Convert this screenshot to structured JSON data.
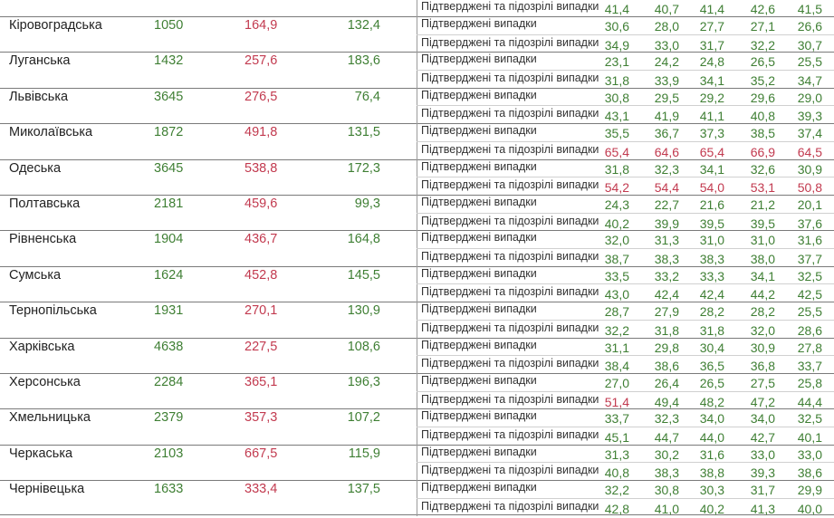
{
  "row_labels": {
    "confirmed": "Підтверджені випадки",
    "confirmed_suspected": "Підтверджені та підозрілі випадки"
  },
  "colors": {
    "green": "#3f7f34",
    "red": "#c23a4f"
  },
  "partial_top_row": {
    "label": "Підтверджені та підозрілі випадки",
    "values": [
      "41,4",
      "40,7",
      "41,4",
      "42,6",
      "41,5"
    ],
    "tones": [
      "green",
      "green",
      "green",
      "green",
      "green"
    ]
  },
  "regions": [
    {
      "name": "Кіровоградська",
      "total": "1050",
      "rate": "164,9",
      "third": "132,4",
      "confirmed": {
        "values": [
          "30,6",
          "28,0",
          "27,7",
          "27,1",
          "26,6"
        ],
        "tones": [
          "green",
          "green",
          "green",
          "green",
          "green"
        ]
      },
      "confirmed_suspected": {
        "values": [
          "34,9",
          "33,0",
          "31,7",
          "32,2",
          "30,7"
        ],
        "tones": [
          "green",
          "green",
          "green",
          "green",
          "green"
        ]
      }
    },
    {
      "name": "Луганська",
      "total": "1432",
      "rate": "257,6",
      "third": "183,6",
      "confirmed": {
        "values": [
          "23,1",
          "24,2",
          "24,8",
          "26,5",
          "25,5"
        ],
        "tones": [
          "green",
          "green",
          "green",
          "green",
          "green"
        ]
      },
      "confirmed_suspected": {
        "values": [
          "31,8",
          "33,9",
          "34,1",
          "35,2",
          "34,7"
        ],
        "tones": [
          "green",
          "green",
          "green",
          "green",
          "green"
        ]
      }
    },
    {
      "name": "Львівська",
      "total": "3645",
      "rate": "276,5",
      "third": "76,4",
      "confirmed": {
        "values": [
          "30,8",
          "29,5",
          "29,2",
          "29,6",
          "29,0"
        ],
        "tones": [
          "green",
          "green",
          "green",
          "green",
          "green"
        ]
      },
      "confirmed_suspected": {
        "values": [
          "43,1",
          "41,9",
          "41,1",
          "40,8",
          "39,3"
        ],
        "tones": [
          "green",
          "green",
          "green",
          "green",
          "green"
        ]
      }
    },
    {
      "name": "Миколаївська",
      "total": "1872",
      "rate": "491,8",
      "third": "131,5",
      "confirmed": {
        "values": [
          "35,5",
          "36,7",
          "37,3",
          "38,5",
          "37,4"
        ],
        "tones": [
          "green",
          "green",
          "green",
          "green",
          "green"
        ]
      },
      "confirmed_suspected": {
        "values": [
          "65,4",
          "64,6",
          "65,4",
          "66,9",
          "64,5"
        ],
        "tones": [
          "red",
          "red",
          "red",
          "red",
          "red"
        ]
      }
    },
    {
      "name": "Одеська",
      "total": "3645",
      "rate": "538,8",
      "third": "172,3",
      "confirmed": {
        "values": [
          "31,8",
          "32,3",
          "34,1",
          "32,6",
          "30,9"
        ],
        "tones": [
          "green",
          "green",
          "green",
          "green",
          "green"
        ]
      },
      "confirmed_suspected": {
        "values": [
          "54,2",
          "54,4",
          "54,0",
          "53,1",
          "50,8"
        ],
        "tones": [
          "red",
          "red",
          "red",
          "red",
          "red"
        ]
      }
    },
    {
      "name": "Полтавська",
      "total": "2181",
      "rate": "459,6",
      "third": "99,3",
      "confirmed": {
        "values": [
          "24,3",
          "22,7",
          "21,6",
          "21,2",
          "20,1"
        ],
        "tones": [
          "green",
          "green",
          "green",
          "green",
          "green"
        ]
      },
      "confirmed_suspected": {
        "values": [
          "40,2",
          "39,9",
          "39,5",
          "39,5",
          "37,6"
        ],
        "tones": [
          "green",
          "green",
          "green",
          "green",
          "green"
        ]
      }
    },
    {
      "name": "Рівненська",
      "total": "1904",
      "rate": "436,7",
      "third": "164,8",
      "confirmed": {
        "values": [
          "32,0",
          "31,3",
          "31,0",
          "31,0",
          "31,6"
        ],
        "tones": [
          "green",
          "green",
          "green",
          "green",
          "green"
        ]
      },
      "confirmed_suspected": {
        "values": [
          "38,7",
          "38,3",
          "38,3",
          "38,0",
          "37,7"
        ],
        "tones": [
          "green",
          "green",
          "green",
          "green",
          "green"
        ]
      }
    },
    {
      "name": "Сумська",
      "total": "1624",
      "rate": "452,8",
      "third": "145,5",
      "confirmed": {
        "values": [
          "33,5",
          "33,2",
          "33,3",
          "34,1",
          "32,5"
        ],
        "tones": [
          "green",
          "green",
          "green",
          "green",
          "green"
        ]
      },
      "confirmed_suspected": {
        "values": [
          "43,0",
          "42,4",
          "42,4",
          "44,2",
          "42,5"
        ],
        "tones": [
          "green",
          "green",
          "green",
          "green",
          "green"
        ]
      }
    },
    {
      "name": "Тернопільська",
      "total": "1931",
      "rate": "270,1",
      "third": "130,9",
      "confirmed": {
        "values": [
          "28,7",
          "27,9",
          "28,2",
          "28,2",
          "25,5"
        ],
        "tones": [
          "green",
          "green",
          "green",
          "green",
          "green"
        ]
      },
      "confirmed_suspected": {
        "values": [
          "32,2",
          "31,8",
          "31,8",
          "32,0",
          "28,6"
        ],
        "tones": [
          "green",
          "green",
          "green",
          "green",
          "green"
        ]
      }
    },
    {
      "name": "Харківська",
      "total": "4638",
      "rate": "227,5",
      "third": "108,6",
      "confirmed": {
        "values": [
          "31,1",
          "29,8",
          "30,4",
          "30,9",
          "27,8"
        ],
        "tones": [
          "green",
          "green",
          "green",
          "green",
          "green"
        ]
      },
      "confirmed_suspected": {
        "values": [
          "38,4",
          "38,6",
          "36,5",
          "36,8",
          "33,7"
        ],
        "tones": [
          "green",
          "green",
          "green",
          "green",
          "green"
        ]
      }
    },
    {
      "name": "Херсонська",
      "total": "2284",
      "rate": "365,1",
      "third": "196,3",
      "confirmed": {
        "values": [
          "27,0",
          "26,4",
          "26,5",
          "27,5",
          "25,8"
        ],
        "tones": [
          "green",
          "green",
          "green",
          "green",
          "green"
        ]
      },
      "confirmed_suspected": {
        "values": [
          "51,4",
          "49,4",
          "48,2",
          "47,2",
          "44,4"
        ],
        "tones": [
          "red",
          "green",
          "green",
          "green",
          "green"
        ]
      }
    },
    {
      "name": "Хмельницька",
      "total": "2379",
      "rate": "357,3",
      "third": "107,2",
      "confirmed": {
        "values": [
          "33,7",
          "32,3",
          "34,0",
          "34,0",
          "32,5"
        ],
        "tones": [
          "green",
          "green",
          "green",
          "green",
          "green"
        ]
      },
      "confirmed_suspected": {
        "values": [
          "45,1",
          "44,7",
          "44,0",
          "42,7",
          "40,1"
        ],
        "tones": [
          "green",
          "green",
          "green",
          "green",
          "green"
        ]
      }
    },
    {
      "name": "Черкаська",
      "total": "2103",
      "rate": "667,5",
      "third": "115,9",
      "confirmed": {
        "values": [
          "31,3",
          "30,2",
          "31,6",
          "33,0",
          "33,0"
        ],
        "tones": [
          "green",
          "green",
          "green",
          "green",
          "green"
        ]
      },
      "confirmed_suspected": {
        "values": [
          "40,8",
          "38,3",
          "38,8",
          "39,3",
          "38,6"
        ],
        "tones": [
          "green",
          "green",
          "green",
          "green",
          "green"
        ]
      }
    },
    {
      "name": "Чернівецька",
      "total": "1633",
      "rate": "333,4",
      "third": "137,5",
      "confirmed": {
        "values": [
          "32,2",
          "30,8",
          "30,3",
          "31,7",
          "29,9"
        ],
        "tones": [
          "green",
          "green",
          "green",
          "green",
          "green"
        ]
      },
      "confirmed_suspected": {
        "values": [
          "42,8",
          "41,0",
          "40,2",
          "41,3",
          "40,0"
        ],
        "tones": [
          "green",
          "green",
          "green",
          "green",
          "green"
        ]
      }
    }
  ]
}
